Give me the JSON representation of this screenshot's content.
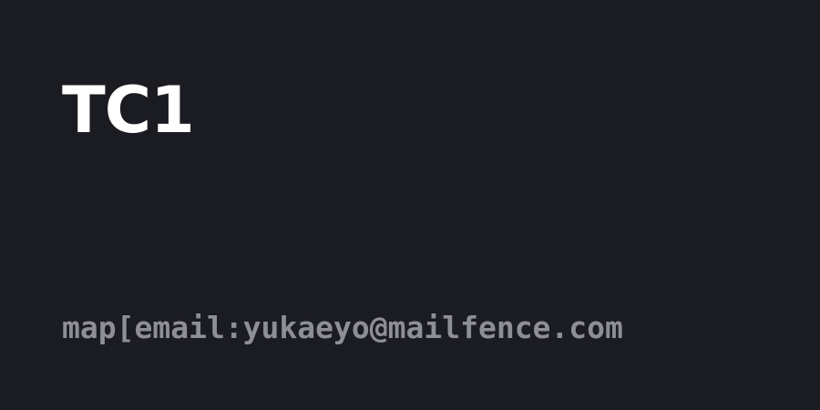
{
  "card": {
    "title": "TC1",
    "meta_text": "map[email:yukaeyo@mailfence.com"
  },
  "colors": {
    "background": "#1b1b22",
    "title": "#ffffff",
    "meta": "#8e8e96"
  }
}
